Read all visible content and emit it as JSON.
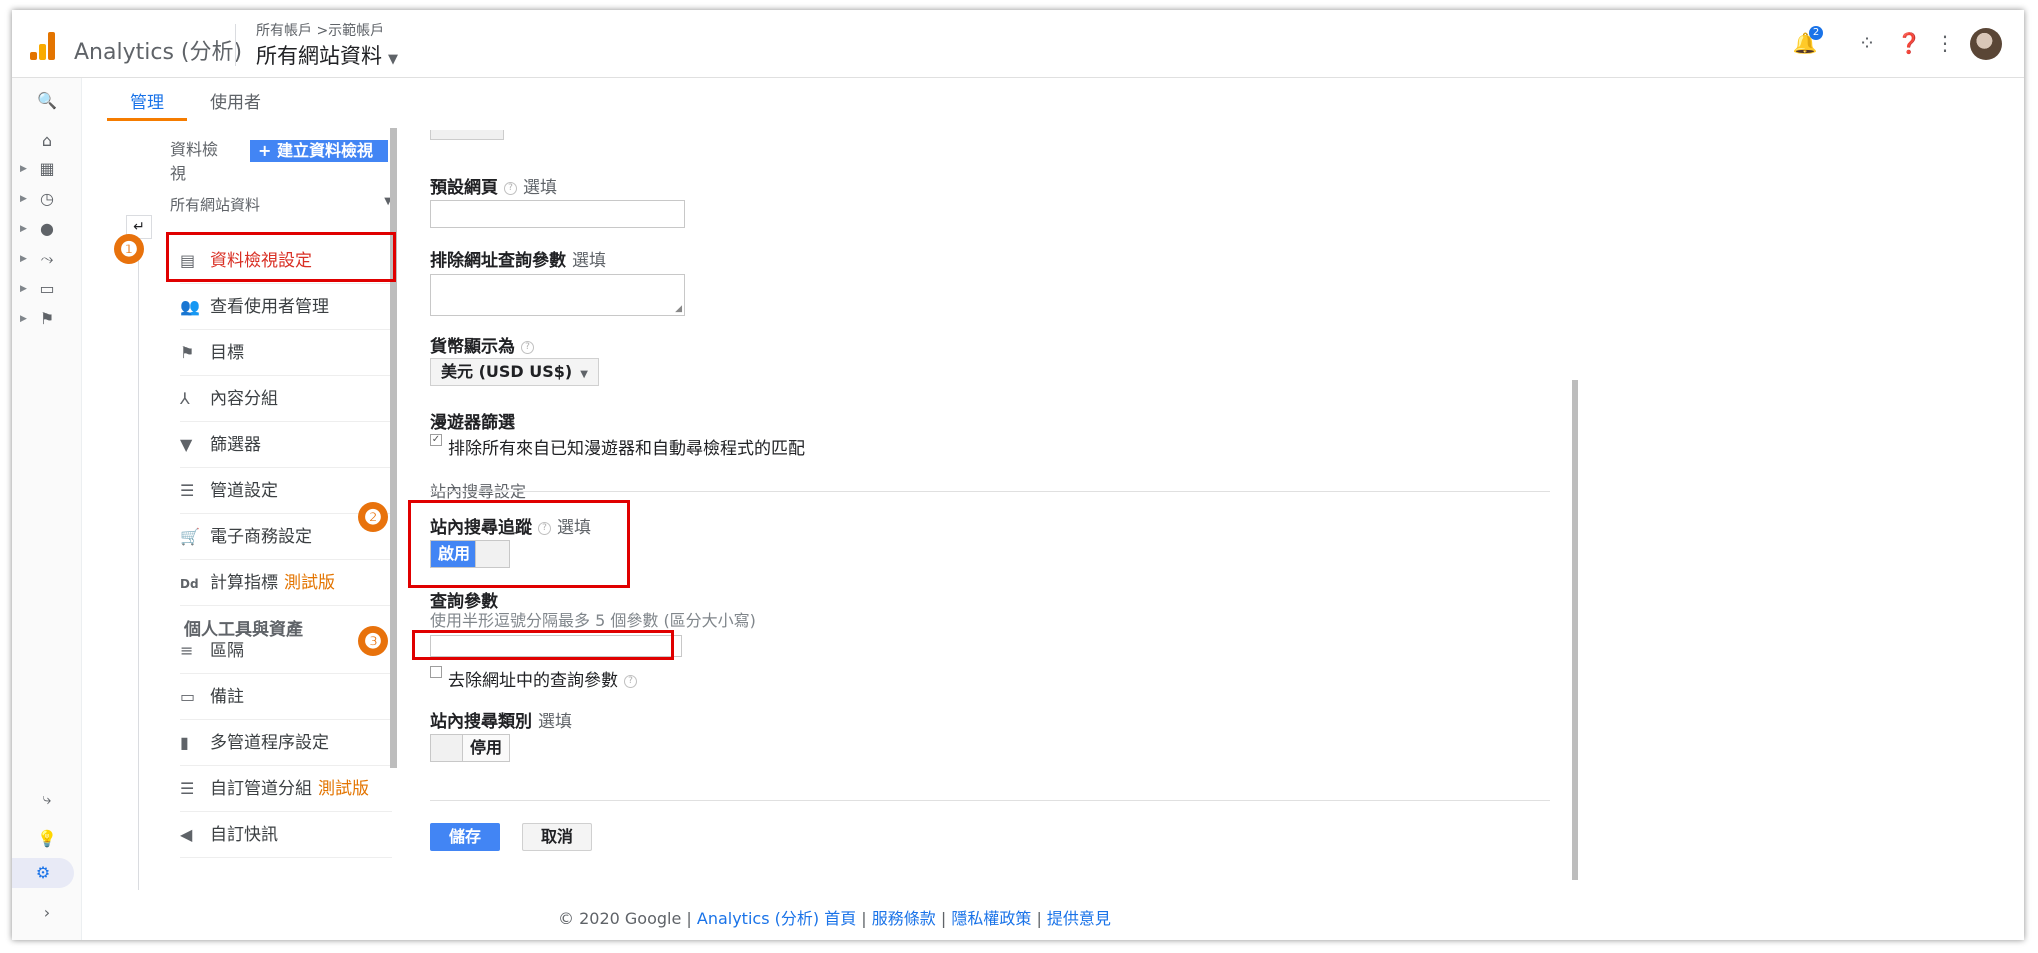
{
  "header": {
    "app_name": "Analytics (分析)",
    "breadcrumb": "所有帳戶 >示範帳戶",
    "property_select": "所有網站資料",
    "notification_count": "2"
  },
  "tabs": [
    {
      "label": "管理"
    },
    {
      "label": "使用者"
    }
  ],
  "admin_nav": {
    "view_label": "資料檢視",
    "create_view_button": "+ 建立資料檢視",
    "view_select": "所有網站資料",
    "back_icon": "↵",
    "items": [
      {
        "label": "資料檢視設定",
        "icon": "page-icon",
        "glyph": "▤"
      },
      {
        "label": "查看使用者管理",
        "icon": "users-icon",
        "glyph": "👥"
      },
      {
        "label": "目標",
        "icon": "flag-icon",
        "glyph": "⚑"
      },
      {
        "label": "內容分組",
        "icon": "person-walk-icon",
        "glyph": "⅄"
      },
      {
        "label": "篩選器",
        "icon": "funnel-icon",
        "glyph": "▼"
      },
      {
        "label": "管道設定",
        "icon": "channel-icon",
        "glyph": "☰"
      },
      {
        "label": "電子商務設定",
        "icon": "cart-icon",
        "glyph": "🛒"
      },
      {
        "label": "計算指標",
        "icon": "dd-icon",
        "glyph": "Dd",
        "beta": "測試版"
      }
    ],
    "personal_heading": "個人工具與資產",
    "personal_items": [
      {
        "label": "區隔",
        "icon": "segments-icon",
        "glyph": "≡"
      },
      {
        "label": "備註",
        "icon": "comment-icon",
        "glyph": "▭"
      },
      {
        "label": "多管道程序設定",
        "icon": "bar-chart-icon",
        "glyph": "▮"
      },
      {
        "label": "自訂管道分組",
        "icon": "channel-group-icon",
        "glyph": "☰",
        "beta": "測試版"
      },
      {
        "label": "自訂快訊",
        "icon": "megaphone-icon",
        "glyph": "◀"
      }
    ]
  },
  "form": {
    "default_page_label": "預設網頁",
    "optional": "選填",
    "exclude_params_label": "排除網址查詢參數",
    "currency_label": "貨幣顯示為",
    "currency_value": "美元 (USD US$)",
    "bot_filter_label": "漫遊器篩選",
    "bot_filter_checkbox": "排除所有來自已知漫遊器和自動尋檢程式的匹配",
    "site_search_section": "站內搜尋設定",
    "site_search_tracking_label": "站內搜尋追蹤",
    "toggle_on": "啟用",
    "query_param_label": "查詢參數",
    "query_param_hint": "使用半形逗號分隔最多 5 個參數 (區分大小寫)",
    "query_param_value": "",
    "strip_params_checkbox": "去除網址中的查詢參數",
    "site_search_category_label": "站內搜尋類別",
    "toggle_off": "停用",
    "save_button": "儲存",
    "cancel_button": "取消"
  },
  "annotations": [
    "❶",
    "❷",
    "❸"
  ],
  "footer": {
    "copyright": "© 2020 Google | ",
    "link_home": "Analytics (分析) 首頁",
    "sep": " | ",
    "link_terms": "服務條款",
    "link_privacy": "隱私權政策",
    "link_feedback": "提供意見"
  },
  "colors": {
    "accent_blue": "#4285f4",
    "tab_underline": "#f57c00",
    "highlight_red": "#e00000",
    "badge_orange": "#e8720c",
    "active_nav": "#d93025"
  }
}
